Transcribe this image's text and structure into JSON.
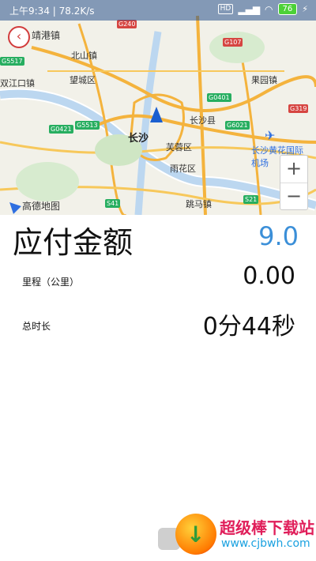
{
  "status_bar": {
    "time": "上午9:34",
    "network_speed": "78.2K/s",
    "sim_label": "HD",
    "battery": "76"
  },
  "map": {
    "back_icon": "chevron-left-icon",
    "place_top_left": "靖港镇",
    "places": {
      "beishan": "北山镇",
      "wangcheng": "望城区",
      "guoyuan": "果园镇",
      "shuangjiangkou": "双江口镇",
      "changsha": "长沙",
      "changsha_county": "长沙县",
      "furong": "芙蓉区",
      "yuhua": "雨花区",
      "airport": "长沙黄花国际机场",
      "yaoma": "跳马镇"
    },
    "road_badges": [
      "G240",
      "G107",
      "G5517",
      "G0401",
      "G319",
      "G5513",
      "G0421",
      "G6021",
      "S41",
      "S21"
    ],
    "zoom_in_label": "+",
    "zoom_out_label": "−",
    "provider_label": "高德地图"
  },
  "fare": {
    "amount_label": "应付金额",
    "amount_value": "9.0",
    "distance_label": "里程（公里）",
    "distance_value": "0.00",
    "duration_label": "总时长",
    "duration_value": "0分44秒"
  },
  "watermark": {
    "site_name": "超级棒下载站",
    "url": "www.cjbwh.com"
  },
  "colors": {
    "accent": "#3b8fd8",
    "back_button": "#d23c3c"
  }
}
